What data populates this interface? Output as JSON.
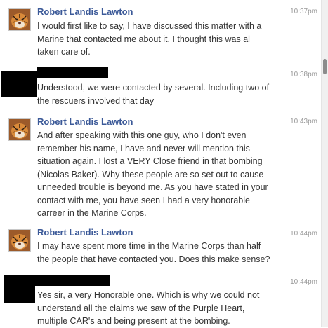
{
  "messages": [
    {
      "sender": "Robert Landis Lawton",
      "time": "10:37pm",
      "lines": [
        "I would first like to say, I have discussed this matter with a",
        "Marine that contacted me about it.  I thought this was al",
        "taken care of."
      ]
    },
    {
      "sender": "",
      "time": "10:38pm",
      "lines": [
        "Understood, we were contacted by several. Including two of",
        "the rescuers involved that day"
      ]
    },
    {
      "sender": "Robert Landis Lawton",
      "time": "10:43pm",
      "lines": [
        "And after speaking with this one guy, who I don't even",
        "remember his name, I have and never will mention this",
        "situation again.  I lost a VERY Close friend in that bombing",
        "(Nicolas Baker). Why these people are so set out to cause",
        "unneeded trouble is beyond me.  As you have stated in your",
        "contact with me, you have seen I had a very honorable",
        "carreer in the Marine Corps."
      ]
    },
    {
      "sender": "Robert Landis Lawton",
      "time": "10:44pm",
      "lines": [
        "I may have spent more time in the Marine Corps than half",
        "the people that  have contacted you.  Does this make sense?"
      ]
    },
    {
      "sender": "",
      "time": "10:44pm",
      "lines": [
        "Yes sir, a very Honorable one. Which is why we could not",
        "understand all the claims we saw of the Purple Heart,",
        "multiple CAR's and being present at the bombing."
      ]
    }
  ],
  "colors": {
    "sender_name": "#3b5998",
    "timestamp": "#999999",
    "redaction": "#000000"
  },
  "icons": {
    "avatar": "tiger-avatar-icon"
  }
}
